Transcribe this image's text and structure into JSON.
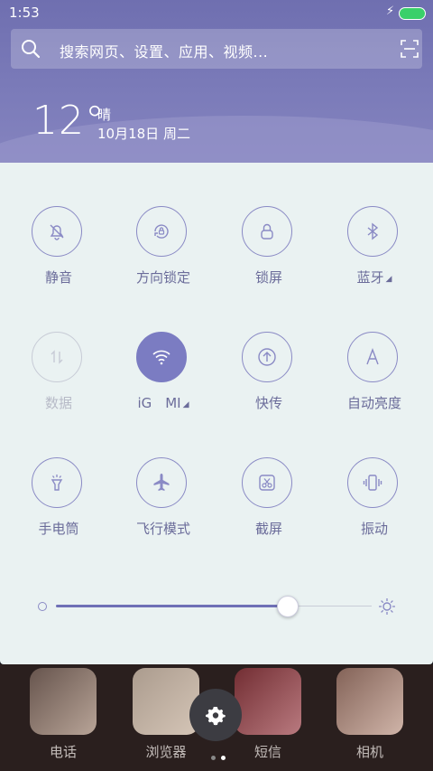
{
  "status": {
    "time": "1:53",
    "battery_color": "#3ad06a"
  },
  "search": {
    "placeholder": "搜索网页、设置、应用、视频..."
  },
  "weather": {
    "temperature": "12°",
    "condition": "晴",
    "date": "10月18日 周二"
  },
  "toggles": [
    {
      "label": "静音",
      "icon": "bell-off-icon",
      "state": "off"
    },
    {
      "label": "方向锁定",
      "icon": "rotation-lock-icon",
      "state": "off"
    },
    {
      "label": "锁屏",
      "icon": "lock-icon",
      "state": "off"
    },
    {
      "label": "蓝牙",
      "icon": "bluetooth-icon",
      "state": "off",
      "expandable": true
    },
    {
      "label": "数据",
      "icon": "mobile-data-icon",
      "state": "disabled"
    },
    {
      "label": "iG　MI",
      "icon": "wifi-icon",
      "state": "on",
      "expandable": true
    },
    {
      "label": "快传",
      "icon": "share-upload-icon",
      "state": "off"
    },
    {
      "label": "自动亮度",
      "icon": "auto-brightness-icon",
      "state": "off"
    },
    {
      "label": "手电筒",
      "icon": "flashlight-icon",
      "state": "off"
    },
    {
      "label": "飞行模式",
      "icon": "airplane-icon",
      "state": "off"
    },
    {
      "label": "截屏",
      "icon": "screenshot-icon",
      "state": "off"
    },
    {
      "label": "振动",
      "icon": "vibrate-icon",
      "state": "off"
    }
  ],
  "brightness": {
    "level": 0.73
  },
  "dock": {
    "apps": [
      {
        "name": "电话"
      },
      {
        "name": "浏览器"
      },
      {
        "name": "短信"
      },
      {
        "name": "相机"
      }
    ]
  },
  "colors": {
    "accent": "#7b7cc2",
    "panel_bg": "#eaf2f2",
    "header_bg": "#7b7bb9"
  }
}
